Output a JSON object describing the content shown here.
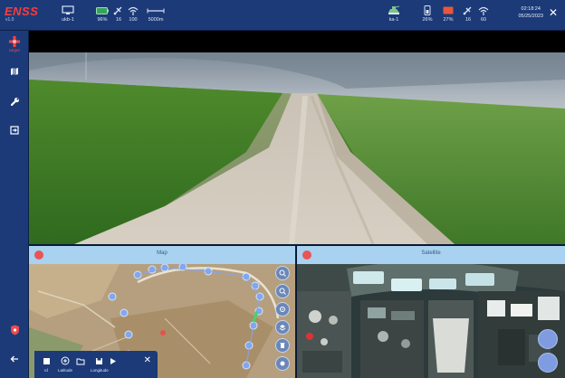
{
  "app": {
    "brand": "ENSS",
    "version": "v1.0"
  },
  "topbar": {
    "unit": {
      "icon": "monitor-icon",
      "label": "ukb-1"
    },
    "left_status": [
      {
        "icon": "battery-icon",
        "label": "96%"
      },
      {
        "icon": "satellite-icon",
        "label": "16"
      },
      {
        "icon": "signal-icon",
        "label": "100"
      },
      {
        "icon": "range-icon",
        "label": "5000m"
      }
    ],
    "vehicle": {
      "icon": "vehicle-icon",
      "label": "ka-1"
    },
    "right_status": [
      {
        "icon": "device-icon",
        "label": "26%"
      },
      {
        "icon": "battery-alert-icon",
        "label": "27%"
      },
      {
        "icon": "satellite-icon",
        "label": "16"
      },
      {
        "icon": "signal-icon",
        "label": "60"
      }
    ],
    "time": "02:18:24",
    "date": "05/25/2023"
  },
  "sidebar": {
    "items": [
      {
        "icon": "target-icon",
        "label": "target",
        "active": true
      },
      {
        "icon": "map-icon",
        "label": ""
      },
      {
        "icon": "wrench-icon",
        "label": ""
      },
      {
        "icon": "exit-icon",
        "label": ""
      }
    ],
    "bottom": [
      {
        "icon": "shield-icon"
      },
      {
        "icon": "back-arrow-icon"
      }
    ]
  },
  "panels": {
    "map": {
      "title": "Map"
    },
    "satellite": {
      "title": "Satellite"
    }
  },
  "waypoint_toolbar": {
    "items": [
      {
        "icon": "checkbox-icon",
        "label": "Id"
      },
      {
        "icon": "add-icon",
        "label": "Latitude"
      },
      {
        "icon": "folder-icon",
        "label": ""
      },
      {
        "icon": "save-icon",
        "label": "Longitude"
      },
      {
        "icon": "play-icon",
        "label": ""
      }
    ]
  },
  "colors": {
    "chrome": "#1c3a78",
    "accent": "#a8d2f0",
    "alert": "#ea5454",
    "waypoint": "#7fa8f5"
  }
}
